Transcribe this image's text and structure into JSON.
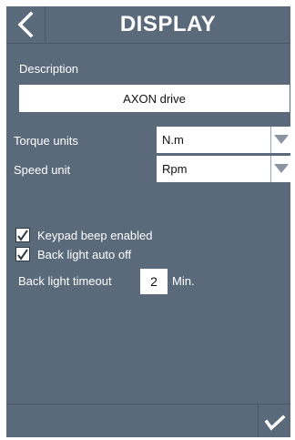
{
  "header": {
    "title": "DISPLAY",
    "back_icon": "chevron-left-icon"
  },
  "description": {
    "label": "Description",
    "value": "AXON drive"
  },
  "torque": {
    "label": "Torque units",
    "selected": "N.m",
    "arrow_icon": "triangle-down-icon"
  },
  "speed": {
    "label": "Speed unit",
    "selected": "Rpm",
    "arrow_icon": "triangle-down-icon"
  },
  "keypad_beep": {
    "label": "Keypad beep enabled",
    "checked": true
  },
  "backlight_auto_off": {
    "label": "Back light auto off",
    "checked": true
  },
  "backlight_timeout": {
    "label": "Back light timeout",
    "value": "2",
    "unit": "Min."
  },
  "footer": {
    "confirm_icon": "checkmark-icon"
  },
  "colors": {
    "panel_background": "#5a6a7b",
    "divider": "#4a5866",
    "text": "#ffffff",
    "field_background": "#ffffff",
    "dropdown_arrow": "#8a95a1"
  }
}
